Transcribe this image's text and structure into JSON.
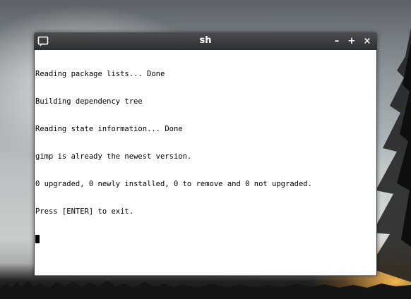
{
  "window": {
    "title": "sh",
    "controls": {
      "minimize_label": "–",
      "maximize_label": "+",
      "close_label": "×"
    },
    "icon": "terminal-window-icon"
  },
  "terminal": {
    "lines": [
      "Reading package lists... Done",
      "Building dependency tree",
      "Reading state information... Done",
      "gimp is already the newest version.",
      "0 upgraded, 0 newly installed, 0 to remove and 0 not upgraded.",
      "Press [ENTER] to exit."
    ],
    "cursor": "block-cursor"
  },
  "colors": {
    "titlebar": "#2d2f31",
    "title_text": "#ffffff",
    "terminal_bg": "#ffffff",
    "terminal_fg": "#000000"
  }
}
